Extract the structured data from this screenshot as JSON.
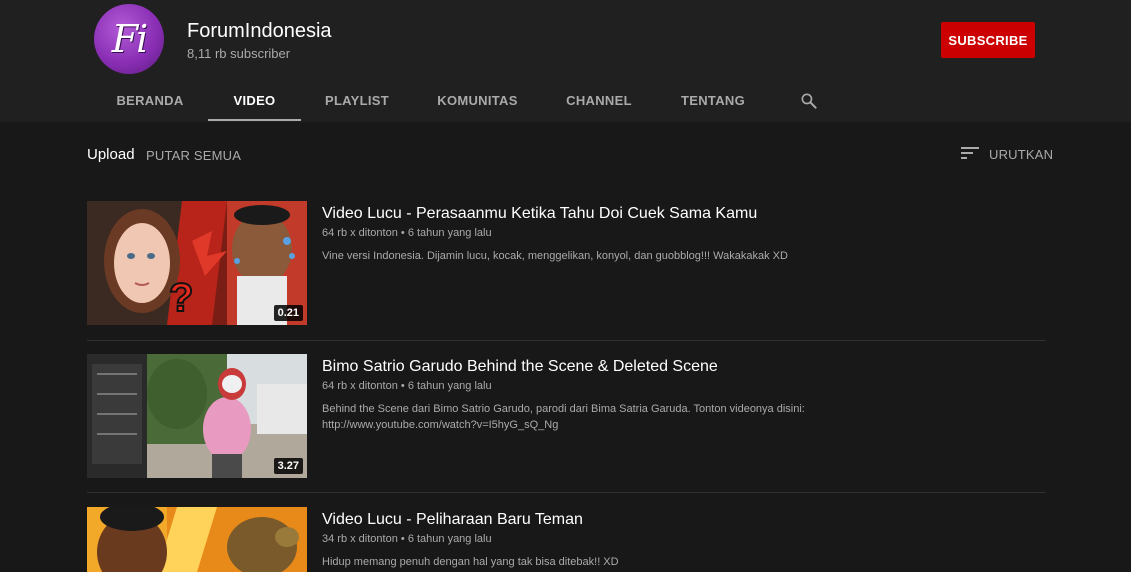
{
  "channel": {
    "avatar_text": "Fi",
    "name": "ForumIndonesia",
    "subscribers": "8,11 rb subscriber",
    "subscribe_label": "SUBSCRIBE"
  },
  "tabs": [
    {
      "label": "BERANDA"
    },
    {
      "label": "VIDEO"
    },
    {
      "label": "PLAYLIST"
    },
    {
      "label": "KOMUNITAS"
    },
    {
      "label": "CHANNEL"
    },
    {
      "label": "TENTANG"
    }
  ],
  "search_icon": "search-icon",
  "toolbar": {
    "upload_label": "Upload",
    "play_all_label": "PUTAR SEMUA",
    "sort_label": "URUTKAN",
    "sort_icon": "sort-icon"
  },
  "videos": [
    {
      "title": "Video Lucu - Perasaanmu Ketika Tahu Doi Cuek Sama Kamu",
      "views": "64 rb x ditonton",
      "age": "6 tahun yang lalu",
      "description": "Vine versi Indonesia. Dijamin lucu, kocak, menggelikan, konyol, dan guobblog!!! Wakakakak XD",
      "description_line2": "",
      "duration": "0.21"
    },
    {
      "title": "Bimo Satrio Garudo Behind the Scene & Deleted Scene",
      "views": "64 rb x ditonton",
      "age": "6 tahun yang lalu",
      "description": "Behind the Scene dari Bimo Satrio Garudo, parodi dari Bima Satria Garuda. Tonton videonya disini:",
      "description_line2": "http://www.youtube.com/watch?v=I5hyG_sQ_Ng",
      "duration": "3.27"
    },
    {
      "title": "Video Lucu - Peliharaan Baru Teman",
      "views": "34 rb x ditonton",
      "age": "6 tahun yang lalu",
      "description": "Hidup memang penuh dengan hal yang tak bisa ditebak!! XD",
      "description_line2": "",
      "duration": ""
    }
  ],
  "colors": {
    "background": "#181818",
    "header": "#202020",
    "subscribe": "#cc0000",
    "avatar": "#8a2fb5"
  }
}
